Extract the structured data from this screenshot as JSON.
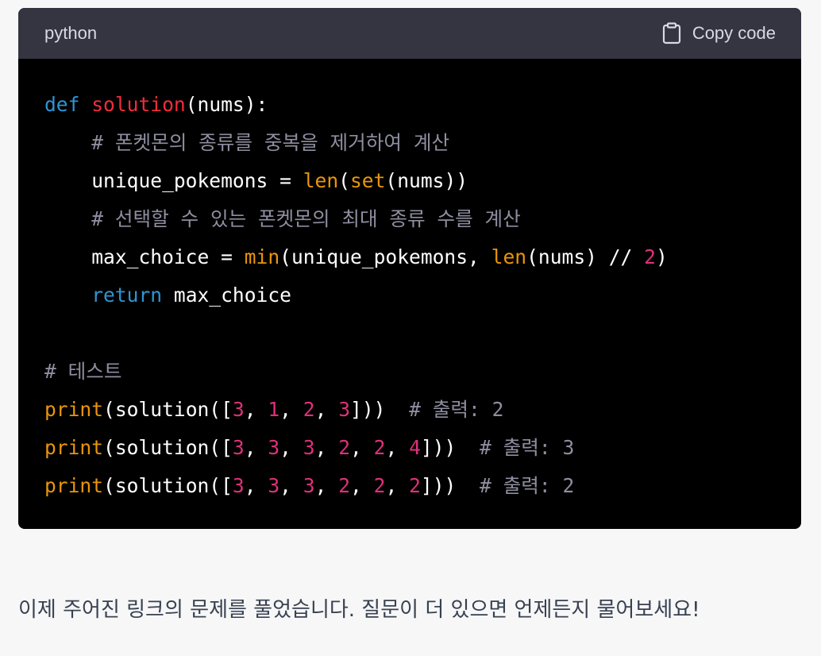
{
  "code_block": {
    "language": "python",
    "copy_label": "Copy code",
    "lines": [
      [
        {
          "t": "kw",
          "v": "def"
        },
        {
          "t": "tx",
          "v": " "
        },
        {
          "t": "fn",
          "v": "solution"
        },
        {
          "t": "tx",
          "v": "(nums):"
        }
      ],
      [
        {
          "t": "tx",
          "v": "    "
        },
        {
          "t": "cm",
          "v": "# 폰켓몬의 종류를 중복을 제거하여 계산"
        }
      ],
      [
        {
          "t": "tx",
          "v": "    unique_pokemons = "
        },
        {
          "t": "bi",
          "v": "len"
        },
        {
          "t": "tx",
          "v": "("
        },
        {
          "t": "bi",
          "v": "set"
        },
        {
          "t": "tx",
          "v": "(nums))"
        }
      ],
      [
        {
          "t": "tx",
          "v": "    "
        },
        {
          "t": "cm",
          "v": "# 선택할 수 있는 폰켓몬의 최대 종류 수를 계산"
        }
      ],
      [
        {
          "t": "tx",
          "v": "    max_choice = "
        },
        {
          "t": "bi",
          "v": "min"
        },
        {
          "t": "tx",
          "v": "(unique_pokemons, "
        },
        {
          "t": "bi",
          "v": "len"
        },
        {
          "t": "tx",
          "v": "(nums) // "
        },
        {
          "t": "num",
          "v": "2"
        },
        {
          "t": "tx",
          "v": ")"
        }
      ],
      [
        {
          "t": "tx",
          "v": "    "
        },
        {
          "t": "kw",
          "v": "return"
        },
        {
          "t": "tx",
          "v": " max_choice"
        }
      ],
      [],
      [
        {
          "t": "cm",
          "v": "# 테스트"
        }
      ],
      [
        {
          "t": "bi",
          "v": "print"
        },
        {
          "t": "tx",
          "v": "(solution(["
        },
        {
          "t": "num",
          "v": "3"
        },
        {
          "t": "tx",
          "v": ", "
        },
        {
          "t": "num",
          "v": "1"
        },
        {
          "t": "tx",
          "v": ", "
        },
        {
          "t": "num",
          "v": "2"
        },
        {
          "t": "tx",
          "v": ", "
        },
        {
          "t": "num",
          "v": "3"
        },
        {
          "t": "tx",
          "v": "]))  "
        },
        {
          "t": "cm",
          "v": "# 출력: 2"
        }
      ],
      [
        {
          "t": "bi",
          "v": "print"
        },
        {
          "t": "tx",
          "v": "(solution(["
        },
        {
          "t": "num",
          "v": "3"
        },
        {
          "t": "tx",
          "v": ", "
        },
        {
          "t": "num",
          "v": "3"
        },
        {
          "t": "tx",
          "v": ", "
        },
        {
          "t": "num",
          "v": "3"
        },
        {
          "t": "tx",
          "v": ", "
        },
        {
          "t": "num",
          "v": "2"
        },
        {
          "t": "tx",
          "v": ", "
        },
        {
          "t": "num",
          "v": "2"
        },
        {
          "t": "tx",
          "v": ", "
        },
        {
          "t": "num",
          "v": "4"
        },
        {
          "t": "tx",
          "v": "]))  "
        },
        {
          "t": "cm",
          "v": "# 출력: 3"
        }
      ],
      [
        {
          "t": "bi",
          "v": "print"
        },
        {
          "t": "tx",
          "v": "(solution(["
        },
        {
          "t": "num",
          "v": "3"
        },
        {
          "t": "tx",
          "v": ", "
        },
        {
          "t": "num",
          "v": "3"
        },
        {
          "t": "tx",
          "v": ", "
        },
        {
          "t": "num",
          "v": "3"
        },
        {
          "t": "tx",
          "v": ", "
        },
        {
          "t": "num",
          "v": "2"
        },
        {
          "t": "tx",
          "v": ", "
        },
        {
          "t": "num",
          "v": "2"
        },
        {
          "t": "tx",
          "v": ", "
        },
        {
          "t": "num",
          "v": "2"
        },
        {
          "t": "tx",
          "v": "]))  "
        },
        {
          "t": "cm",
          "v": "# 출력: 2"
        }
      ]
    ]
  },
  "message": {
    "text": "이제 주어진 링크의 문제를 풀었습니다. 질문이 더 있으면 언제든지 물어보세요!"
  },
  "colors": {
    "header_bg": "#343541",
    "code_bg": "#000000",
    "keyword": "#2e95d3",
    "function_name": "#f22c3d",
    "builtin": "#e9950c",
    "number": "#df3079",
    "comment": "#8e8ea0",
    "page_bg": "#f7f7f8"
  },
  "icons": {
    "copy": "clipboard-icon"
  }
}
